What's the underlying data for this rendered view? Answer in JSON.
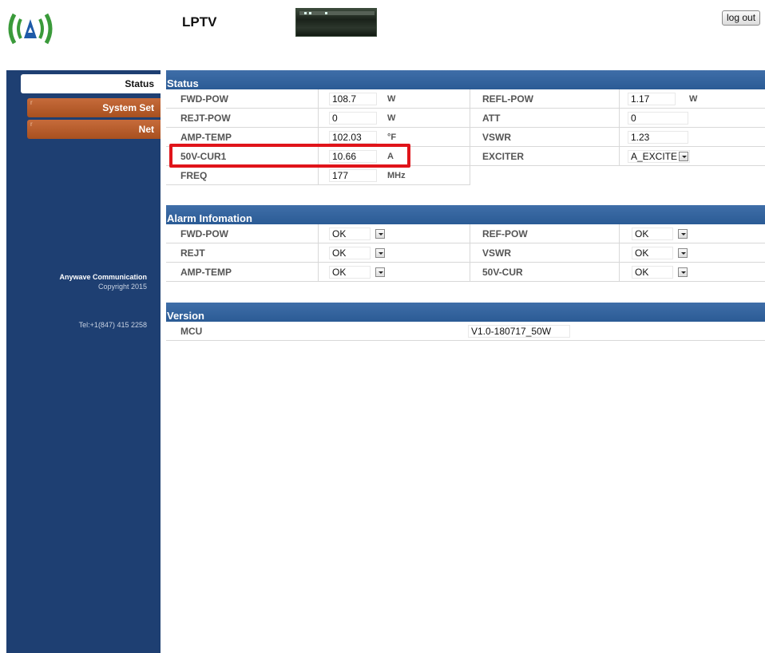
{
  "header": {
    "logo_text": "(A)",
    "app_title": "LPTV",
    "logout_label": "log out"
  },
  "sidebar": {
    "items": [
      {
        "label": "Status"
      },
      {
        "label": "System Set"
      },
      {
        "label": "Net"
      }
    ],
    "company": "Anywave Communication",
    "copyright": "Copyright 2015",
    "tel": "Tel:+1(847) 415 2258"
  },
  "status": {
    "title": "Status",
    "fwd_pow": {
      "label": "FWD-POW",
      "value": "108.7",
      "unit": "W"
    },
    "refl_pow": {
      "label": "REFL-POW",
      "value": "1.17",
      "unit": "W"
    },
    "rejt_pow": {
      "label": "REJT-POW",
      "value": "0",
      "unit": "W"
    },
    "att": {
      "label": "ATT",
      "value": "0"
    },
    "amp_temp": {
      "label": "AMP-TEMP",
      "value": "102.03",
      "unit": "°F"
    },
    "vswr": {
      "label": "VSWR",
      "value": "1.23"
    },
    "cur1": {
      "label": "50V-CUR1",
      "value": "10.66",
      "unit": "A"
    },
    "exciter": {
      "label": "EXCITER",
      "value": "A_EXCITE"
    },
    "freq": {
      "label": "FREQ",
      "value": "177",
      "unit": "MHz"
    }
  },
  "alarm": {
    "title": "Alarm Infomation",
    "rows": [
      {
        "left_label": "FWD-POW",
        "left_value": "OK",
        "right_label": "REF-POW",
        "right_value": "OK"
      },
      {
        "left_label": "REJT",
        "left_value": "OK",
        "right_label": "VSWR",
        "right_value": "OK"
      },
      {
        "left_label": "AMP-TEMP",
        "left_value": "OK",
        "right_label": "50V-CUR",
        "right_value": "OK"
      }
    ]
  },
  "version": {
    "title": "Version",
    "label": "MCU",
    "value": "V1.0-180717_50W"
  },
  "colors": {
    "sidebar": "#1e3f72",
    "section_header": "#3a67a0",
    "nav_orange": "#b85c2a",
    "highlight": "#e0141a"
  }
}
